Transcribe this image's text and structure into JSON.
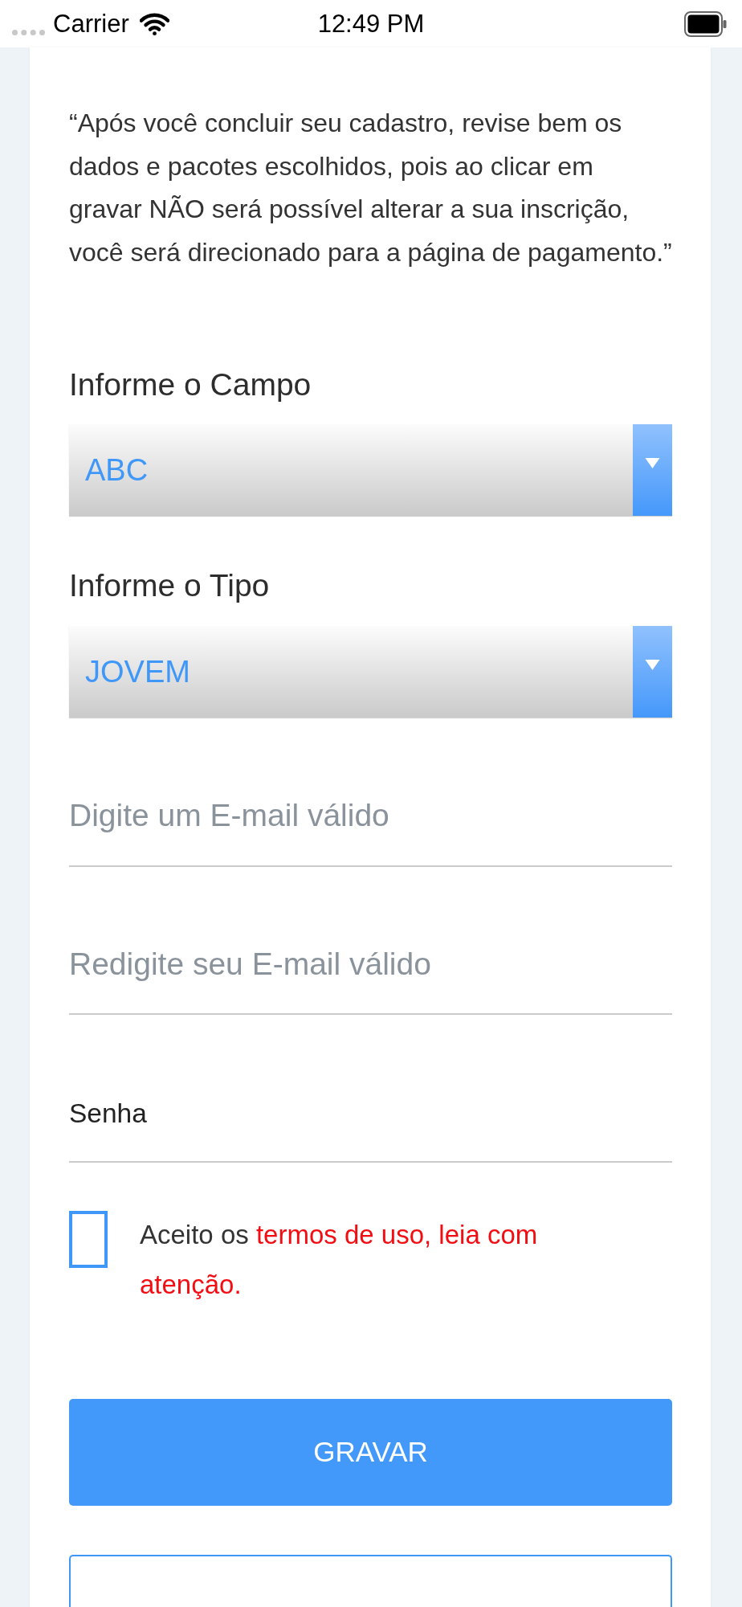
{
  "status_bar": {
    "carrier": "Carrier",
    "time": "12:49 PM"
  },
  "notice": "“Após você concluir seu cadastro, revise bem os dados e pacotes escolhidos, pois ao clicar em gravar NÃO será possível alterar a sua inscrição, você será direcionado para a página de pagamento.”",
  "selects": [
    {
      "label": "Informe o Campo",
      "value": "ABC"
    },
    {
      "label": "Informe o Tipo",
      "value": "JOVEM"
    }
  ],
  "fields": [
    {
      "kind": "email",
      "placeholder": "Digite um E-mail válido"
    },
    {
      "kind": "email",
      "placeholder": "Redigite seu E-mail válido"
    },
    {
      "kind": "password",
      "placeholder": "Senha"
    }
  ],
  "terms": {
    "checked": false,
    "text": "Aceito os",
    "highlighted": "termos de uso, leia com atenção."
  },
  "buttons": [
    {
      "kind": "filled",
      "label": "GRAVAR"
    },
    {
      "kind": "outline"
    }
  ]
}
